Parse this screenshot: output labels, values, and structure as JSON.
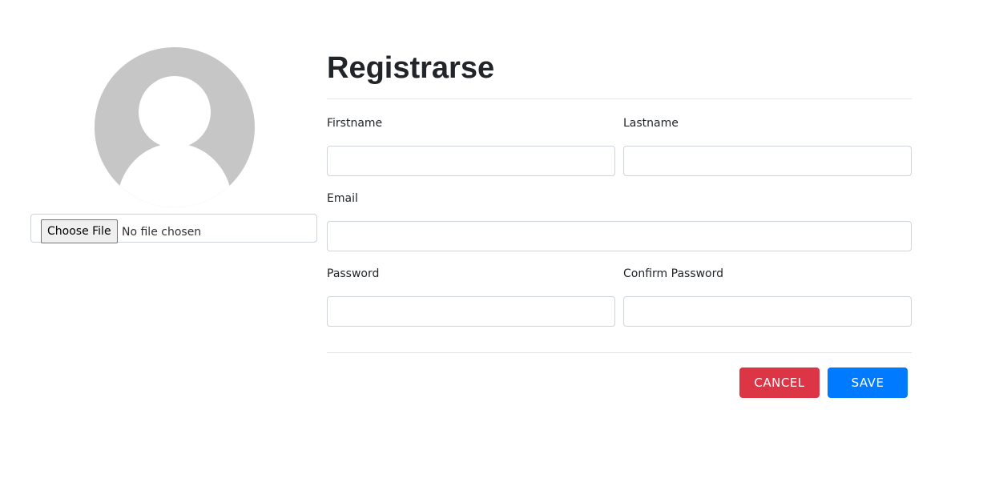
{
  "avatar": {
    "icon": "user-silhouette-icon",
    "background": "#c6c6c6"
  },
  "file_input": {
    "button_label": "Choose File",
    "status": "No file chosen"
  },
  "form": {
    "title": "Registrarse",
    "firstname_label": "Firstname",
    "lastname_label": "Lastname",
    "email_label": "Email",
    "password_label": "Password",
    "confirm_password_label": "Confirm Password",
    "firstname_value": "",
    "lastname_value": "",
    "email_value": "",
    "password_value": "",
    "confirm_password_value": ""
  },
  "actions": {
    "cancel_label": "CANCEL",
    "save_label": "SAVE"
  },
  "colors": {
    "cancel": "#dc3545",
    "save": "#007bff",
    "text": "#212529",
    "input_border": "#ced4da"
  }
}
